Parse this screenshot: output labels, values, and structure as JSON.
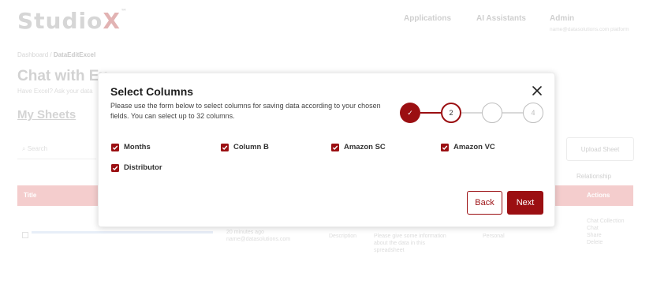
{
  "header": {
    "logo_main": "Studio",
    "logo_x": "X",
    "logo_mark": "™",
    "nav_applications": "Applications",
    "nav_ai_assistants": "AI Assistants",
    "nav_admin": "Admin",
    "admin_sub": "name@datasolutions.com platform"
  },
  "page": {
    "breadcrumb_root": "Dashboard",
    "breadcrumb_sep": " / ",
    "breadcrumb_current": "DataEditExcel",
    "title": "Chat with Ex",
    "subtitle": "Have Excel? Ask your data",
    "sheets_heading": "My Sheets",
    "search_placeholder": "Search",
    "upload_button": "Upload Sheet",
    "collab_header": "Relationship",
    "table_header_left": "Title",
    "table_header_right": "Actions",
    "row_col2_line1": "20 minutes ago",
    "row_col2_line2": "name@datasolutions.com",
    "row_col3_label": "Description",
    "row_col3_line1": "Please give some information",
    "row_col3_line2": "about the data in this",
    "row_col3_line3": "spreadsheet",
    "row_col4": "Personal",
    "row_actions": [
      "Chat Collection",
      "Chat",
      "Share",
      "Delete"
    ]
  },
  "modal": {
    "title": "Select Columns",
    "description": "Please use the form below to select columns for saving data according to your chosen fields. You can select up to 32 columns.",
    "close_icon": "close-icon",
    "steps": [
      {
        "label": "✓",
        "state": "done"
      },
      {
        "label": "2",
        "state": "active"
      },
      {
        "label": "",
        "state": "idle"
      },
      {
        "label": "4",
        "state": "idle"
      }
    ],
    "columns": [
      {
        "label": "Months",
        "checked": true
      },
      {
        "label": "Column B",
        "checked": true
      },
      {
        "label": "Amazon SC",
        "checked": true
      },
      {
        "label": "Amazon VC",
        "checked": true
      },
      {
        "label": "Distributor",
        "checked": true
      }
    ],
    "back_label": "Back",
    "next_label": "Next"
  },
  "colors": {
    "accent": "#9b0f12",
    "idle": "#bdbdbd"
  }
}
